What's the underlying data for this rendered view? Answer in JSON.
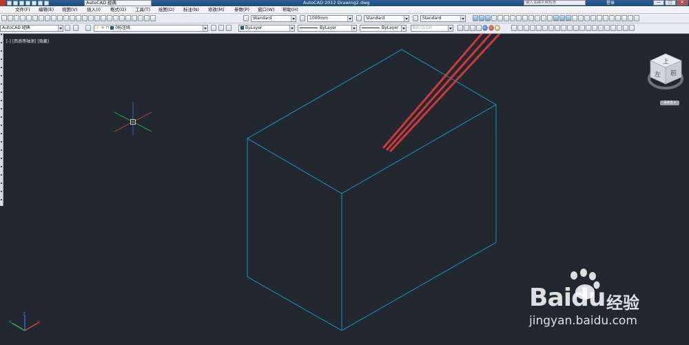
{
  "title_bar": {
    "workspace": "AutoCAD 经典",
    "title": "AutoCAD 2012    Drawing2.dwg",
    "search_placeholder": "键入关键字或短语",
    "login": "登录",
    "controls": [
      "—",
      "▢",
      "✕"
    ]
  },
  "menu": [
    "文件(F)",
    "编辑(E)",
    "视图(V)",
    "插入(I)",
    "格式(O)",
    "工具(T)",
    "绘图(D)",
    "标注(N)",
    "修改(M)",
    "参数(P)",
    "窗口(W)",
    "帮助(H)"
  ],
  "styles_toolbar": {
    "text_style": "Standard",
    "dim_value": "1000mm",
    "table_style": "Standard",
    "mleader_style": "Standard"
  },
  "layers_toolbar": {
    "workspace": "AutoCAD 经典",
    "layer": "0标注线",
    "color": "ByLayer",
    "linetype": "ByLayer",
    "lineweight": "ByLayer",
    "plot_style": "BYCOLOR"
  },
  "viewport": {
    "label": "[-] [西南等轴测] [隐藏]"
  },
  "view_cube": {
    "top_label": "上",
    "left_label": "左",
    "front_label": "前",
    "wcs_label": "未命名 ▾"
  },
  "ucs_icon": {
    "x_label": "X",
    "y_label": "Y",
    "z_label": "Z"
  },
  "watermark": {
    "brand": "Baidu",
    "suffix": "经验",
    "url": "jingyan.baidu.com"
  },
  "colors": {
    "canvas": "#212830",
    "box_edges": "#1aa3c4",
    "annotation_arrows": "#e23a3a"
  }
}
